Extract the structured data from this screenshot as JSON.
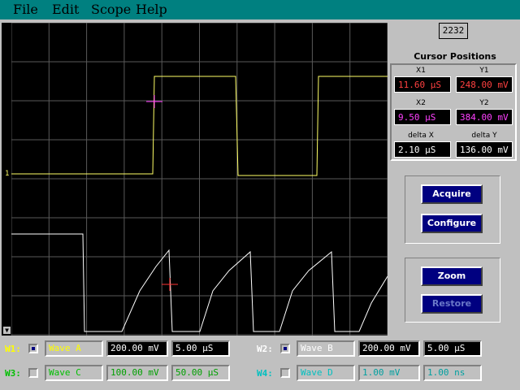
{
  "menu": {
    "file": "File",
    "edit": "Edit",
    "scope": "Scope",
    "help": "Help"
  },
  "counter": "2232",
  "channel_marker": "1",
  "cursor_panel": {
    "title": "Cursor Positions",
    "x1_label": "X1",
    "x1_value": "11.60 µS",
    "y1_label": "Y1",
    "y1_value": "248.00 mV",
    "x2_label": "X2",
    "x2_value": "9.50 µS",
    "y2_label": "Y2",
    "y2_value": "384.00 mV",
    "dx_label": "delta X",
    "dx_value": "2.10 µS",
    "dy_label": "delta Y",
    "dy_value": "136.00 mV"
  },
  "buttons": {
    "acquire": "Acquire",
    "configure": "Configure",
    "zoom": "Zoom",
    "restore": "Restore"
  },
  "channels": {
    "w1": {
      "label": "W1:",
      "name": "Wave A",
      "volts": "200.00 mV",
      "time": "5.00 µS",
      "checked": true
    },
    "w2": {
      "label": "W2:",
      "name": "Wave B",
      "volts": "200.00 mV",
      "time": "5.00 µS",
      "checked": true
    },
    "w3": {
      "label": "W3:",
      "name": "Wave C",
      "volts": "100.00 mV",
      "time": "50.00 µS",
      "checked": false
    },
    "w4": {
      "label": "W4:",
      "name": "Wave D",
      "volts": "1.00 mV",
      "time": "1.00 ns",
      "checked": false
    }
  },
  "colors": {
    "trace_a": "#ffff66",
    "trace_b": "#ffffff",
    "cursor_1": "#ff3333",
    "cursor_2": "#ff33ff",
    "x1_text": "#ff4040",
    "x2_text": "#ff40ff",
    "w1": "#ffff00",
    "w2": "#ffffff",
    "w3": "#00c000",
    "w4": "#00c0c0"
  }
}
